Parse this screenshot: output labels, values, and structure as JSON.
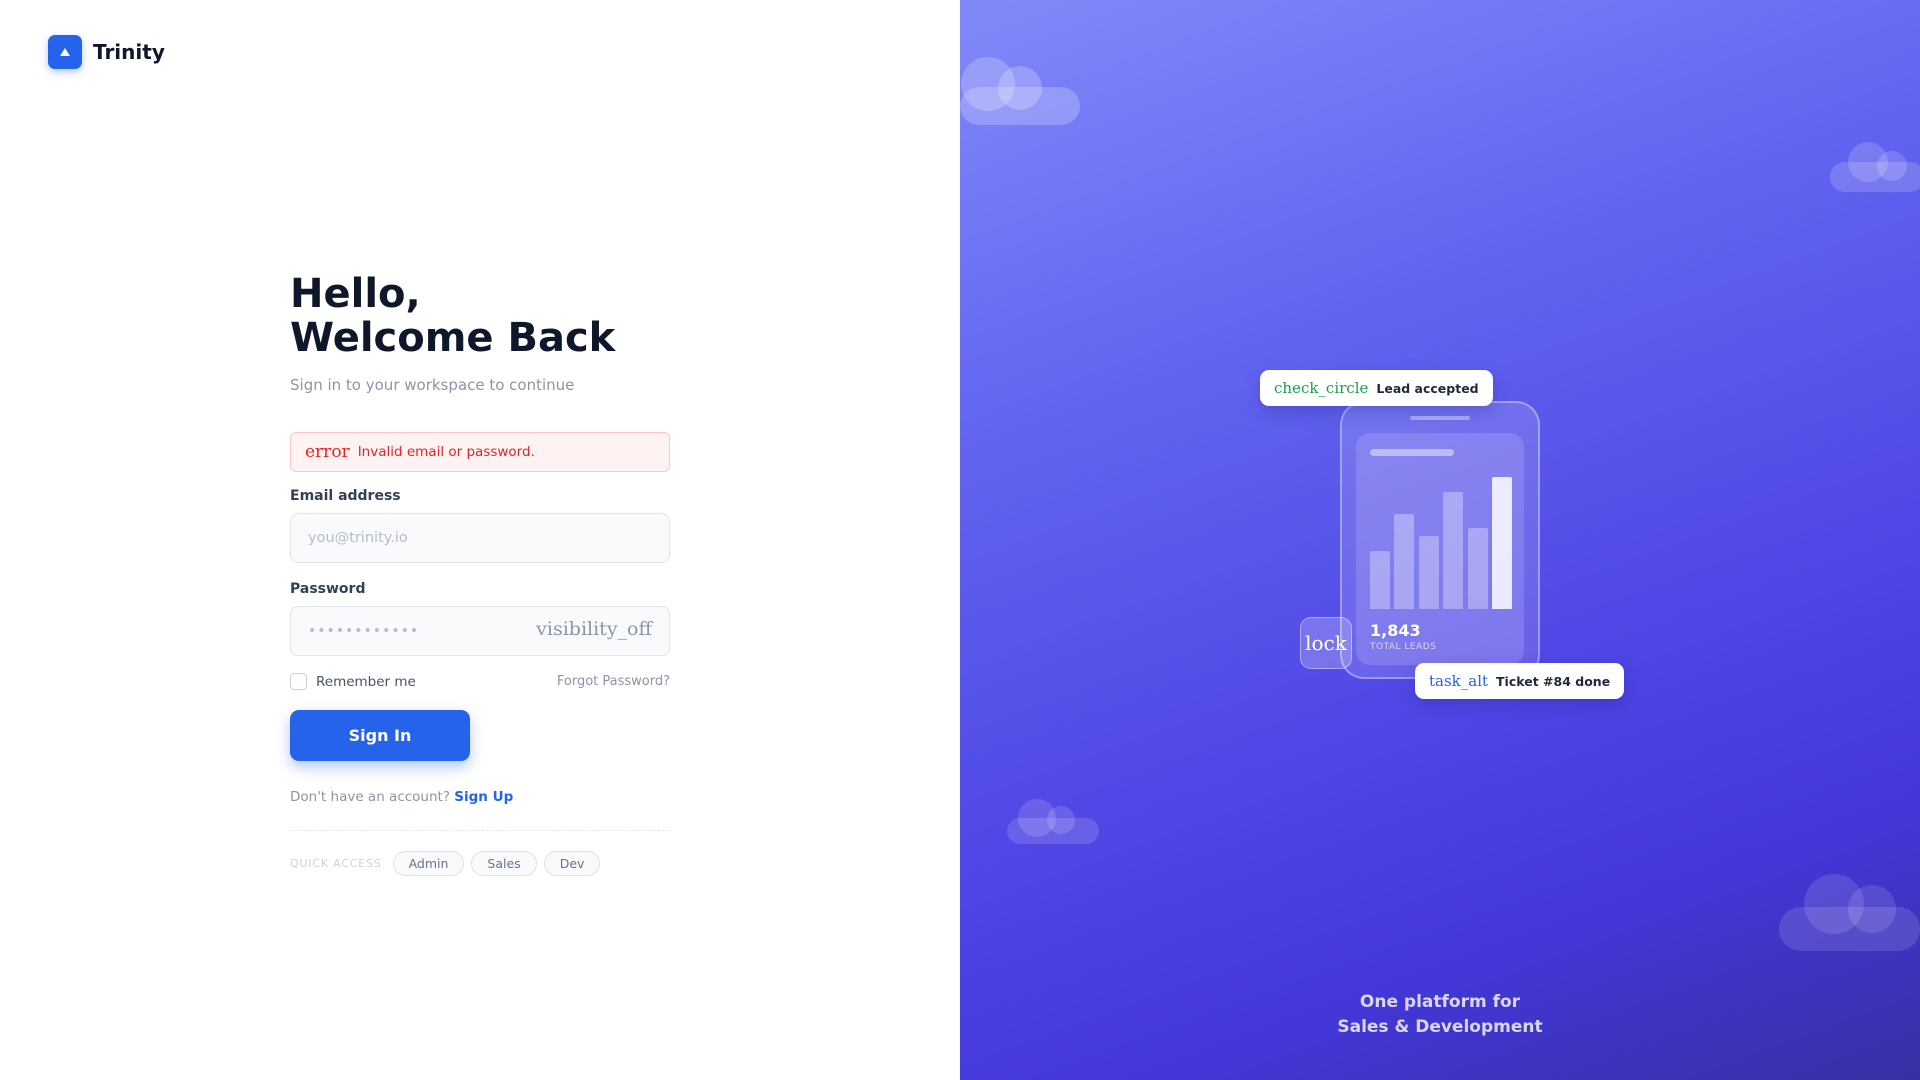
{
  "brand": {
    "name": "Trinity",
    "logo_icon": "triangle-up-icon",
    "accent": "#2563eb"
  },
  "login": {
    "title_line1": "Hello,",
    "title_line2": "Welcome Back",
    "subtitle": "Sign in to your workspace to continue",
    "error": {
      "icon": "error",
      "message": "Invalid email or password.",
      "color": "#dc2626"
    },
    "email": {
      "label": "Email address",
      "value": "",
      "placeholder": "you@trinity.io"
    },
    "password": {
      "label": "Password",
      "value": "••••••••••••",
      "toggle_icon": "visibility_off"
    },
    "remember": {
      "label": "Remember me",
      "checked": false
    },
    "forgot_label": "Forgot Password?",
    "submit_label": "Sign In",
    "signup_prompt": "Don't have an account?",
    "signup_link": "Sign Up",
    "quick_access": {
      "label": "QUICK ACCESS",
      "chips": [
        "Admin",
        "Sales",
        "Dev"
      ]
    }
  },
  "hero": {
    "badge_lead": {
      "icon": "check_circle",
      "label": "Lead accepted",
      "icon_color": "#16a34a"
    },
    "badge_ticket": {
      "icon": "task_alt",
      "label": "Ticket #84 done",
      "icon_color": "#2563eb"
    },
    "lock_icon": "lock",
    "phone_stats": {
      "value": "1,843",
      "label": "TOTAL LEADS",
      "bar_levels": [
        0.44,
        0.72,
        0.55,
        0.89,
        0.61,
        1.0
      ]
    },
    "tagline_line1": "One platform for",
    "tagline_line2": "Sales & Development",
    "gradient": [
      "#8189f8",
      "#6366f1",
      "#4f46e5",
      "#3730a3"
    ]
  }
}
